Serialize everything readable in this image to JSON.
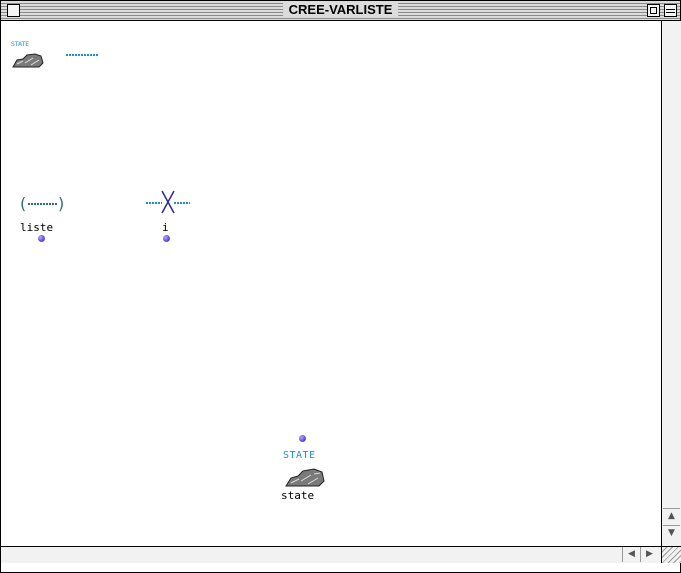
{
  "window": {
    "title": "CREE-VARLISTE"
  },
  "palette": {
    "state_tag": "STATE"
  },
  "boxes": {
    "liste": {
      "label": "liste",
      "icon": "list-paren-icon"
    },
    "i": {
      "label": "i",
      "icon": "cross-variable-icon"
    },
    "state": {
      "label": "state",
      "tag": "STATE",
      "icon": "state-stone-icon"
    }
  },
  "colors": {
    "accent": "#1e8fd6",
    "connector": "#6a4fd8",
    "list_icon": "#2e6f6f"
  }
}
